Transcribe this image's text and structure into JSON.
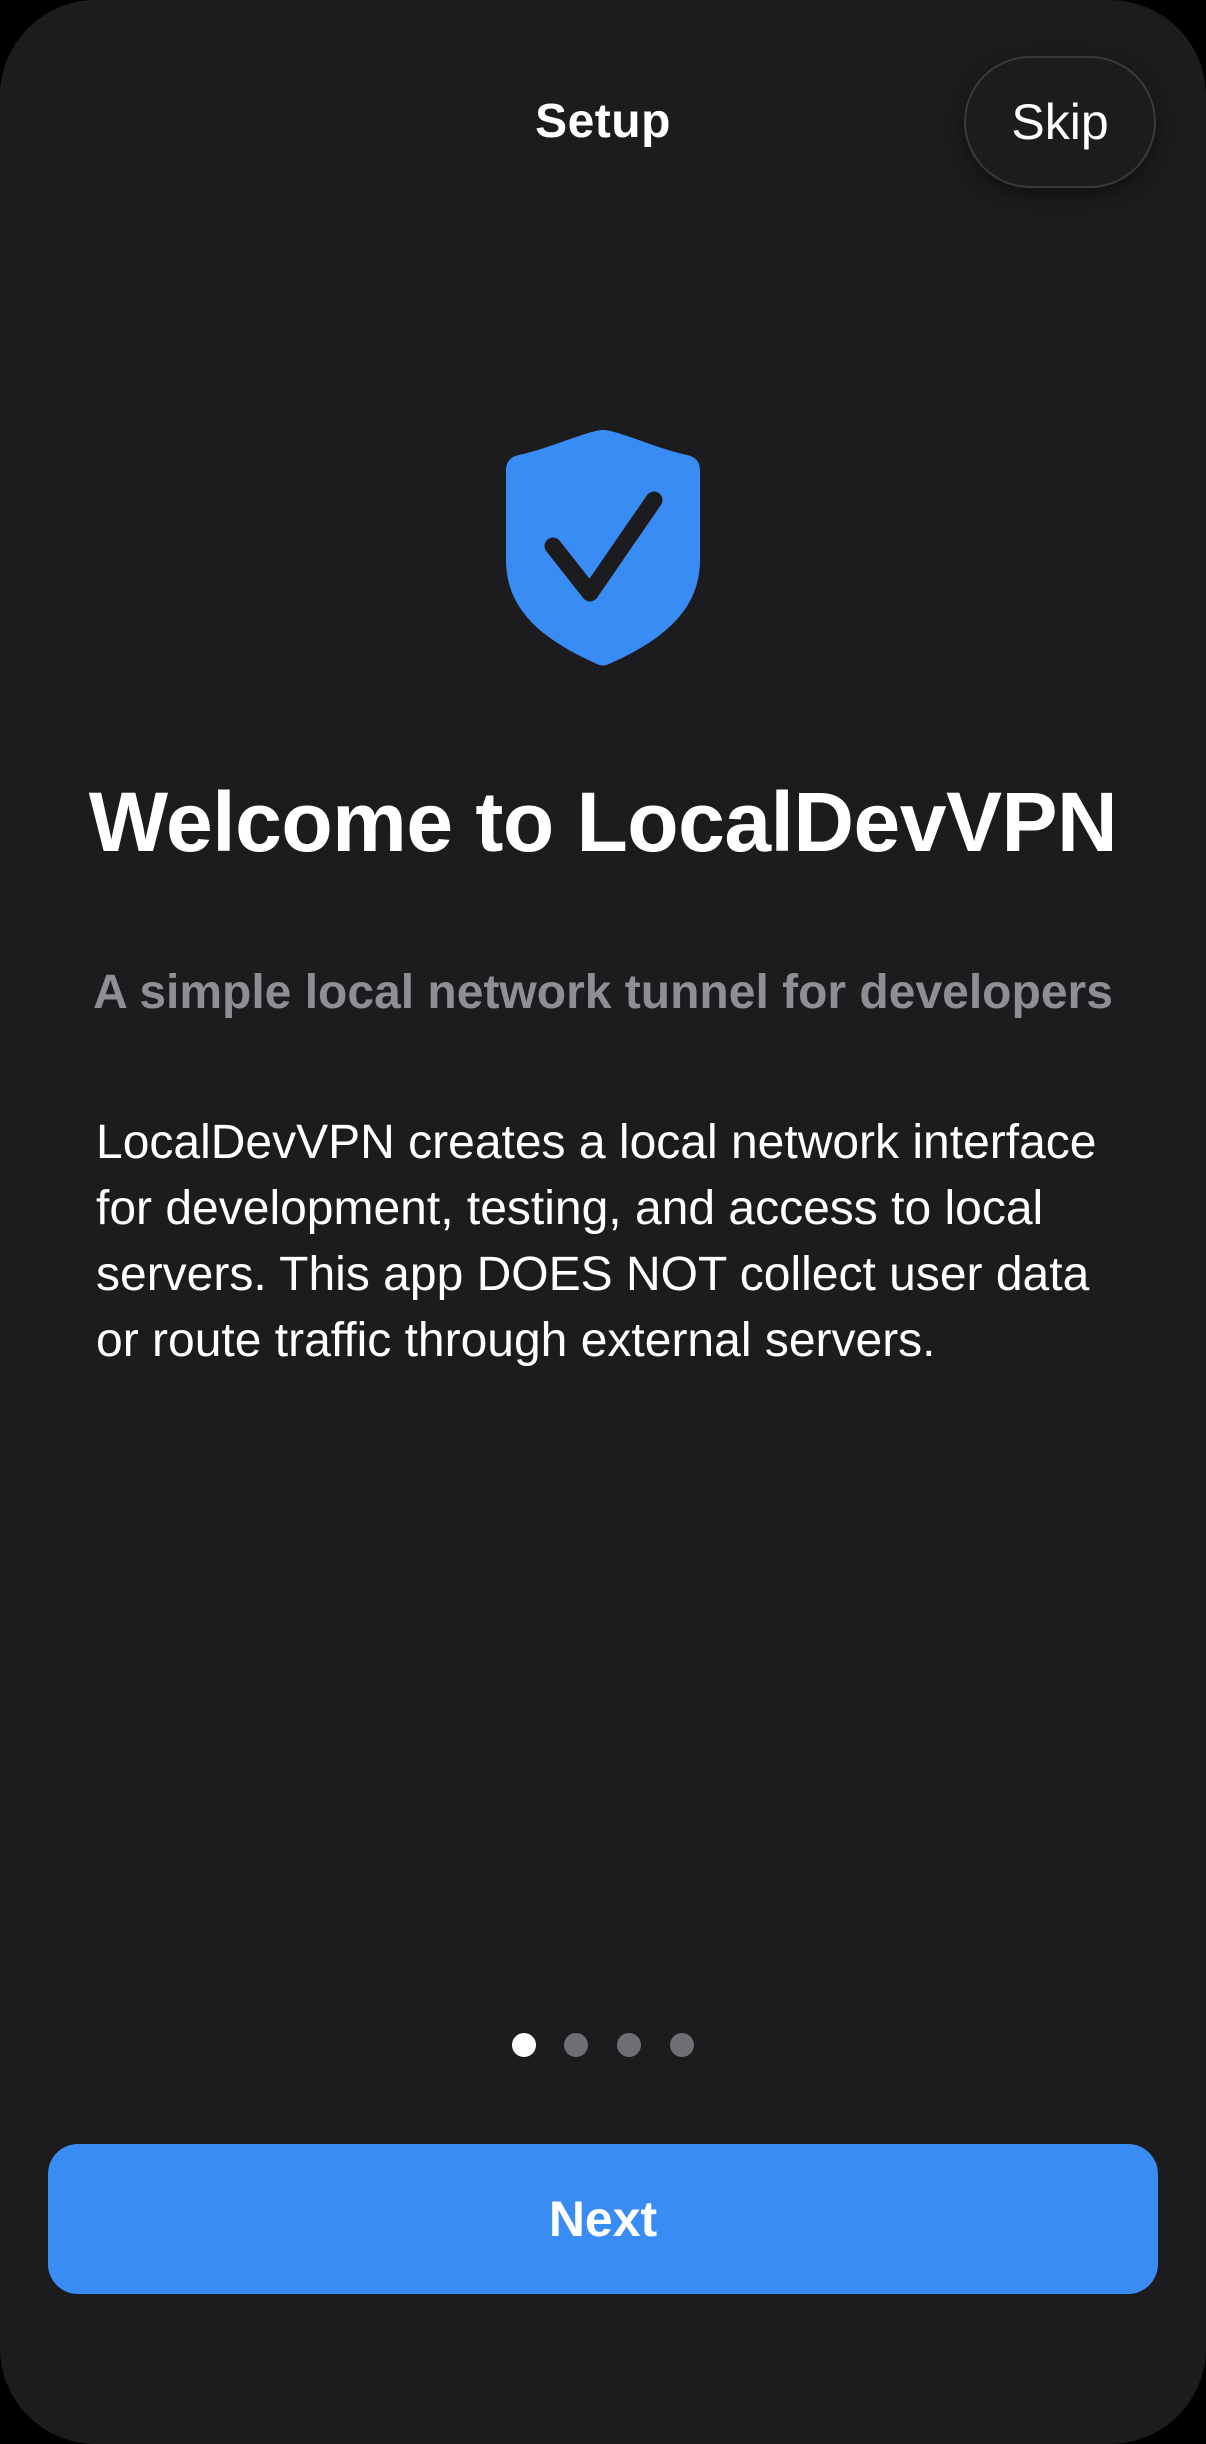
{
  "header": {
    "title": "Setup",
    "skip_label": "Skip"
  },
  "hero": {
    "icon": "shield-checkmark-icon",
    "icon_color": "#3a8cf5"
  },
  "content": {
    "title": "Welcome to LocalDevVPN",
    "subtitle": "A simple local network tunnel for developers",
    "description": "LocalDevVPN creates a local network interface for development, testing, and access to local servers. This app DOES NOT collect user data or route traffic through external servers."
  },
  "pagination": {
    "total": 4,
    "current": 1
  },
  "footer": {
    "next_label": "Next"
  },
  "colors": {
    "background": "#1c1c1e",
    "accent": "#3a8cf5",
    "secondary_text": "#8e8e93"
  }
}
